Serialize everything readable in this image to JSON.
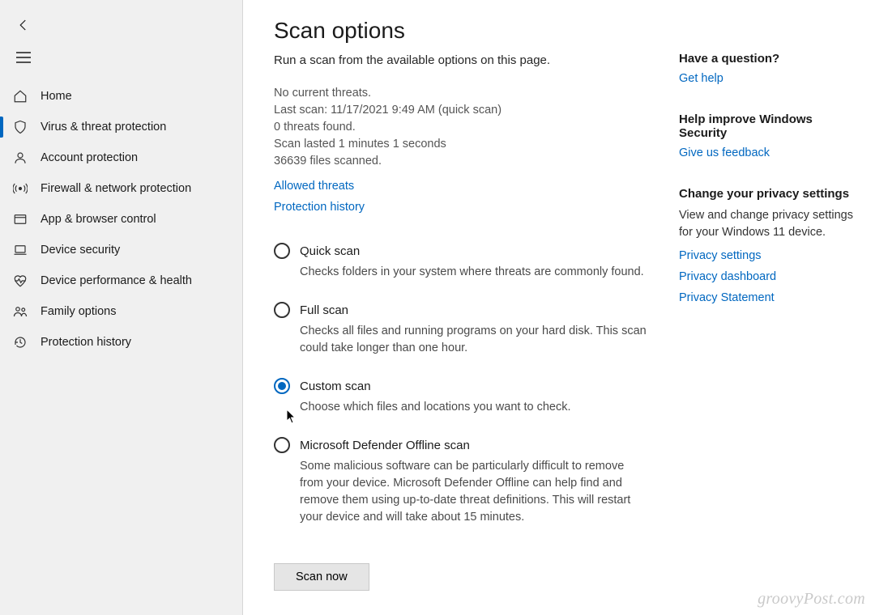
{
  "sidebar": {
    "items": [
      {
        "label": "Home"
      },
      {
        "label": "Virus & threat protection",
        "active": true
      },
      {
        "label": "Account protection"
      },
      {
        "label": "Firewall & network protection"
      },
      {
        "label": "App & browser control"
      },
      {
        "label": "Device security"
      },
      {
        "label": "Device performance & health"
      },
      {
        "label": "Family options"
      },
      {
        "label": "Protection history"
      }
    ]
  },
  "page": {
    "title": "Scan options",
    "subtitle": "Run a scan from the available options on this page.",
    "status": {
      "no_threats": "No current threats.",
      "last_scan": "Last scan: 11/17/2021 9:49 AM (quick scan)",
      "threats_found": "0 threats found.",
      "duration": "Scan lasted 1 minutes 1 seconds",
      "files_scanned": "36639 files scanned."
    },
    "links": {
      "allowed_threats": "Allowed threats",
      "protection_history": "Protection history"
    },
    "options": [
      {
        "title": "Quick scan",
        "desc": "Checks folders in your system where threats are commonly found.",
        "checked": false
      },
      {
        "title": "Full scan",
        "desc": "Checks all files and running programs on your hard disk. This scan could take longer than one hour.",
        "checked": false
      },
      {
        "title": "Custom scan",
        "desc": "Choose which files and locations you want to check.",
        "checked": true
      },
      {
        "title": "Microsoft Defender Offline scan",
        "desc": "Some malicious software can be particularly difficult to remove from your device. Microsoft Defender Offline can help find and remove them using up-to-date threat definitions. This will restart your device and will take about 15 minutes.",
        "checked": false
      }
    ],
    "scan_button": "Scan now"
  },
  "aside": {
    "question": {
      "heading": "Have a question?",
      "link": "Get help"
    },
    "improve": {
      "heading": "Help improve Windows Security",
      "link": "Give us feedback"
    },
    "privacy": {
      "heading": "Change your privacy settings",
      "text": "View and change privacy settings for your Windows 11 device.",
      "links": [
        "Privacy settings",
        "Privacy dashboard",
        "Privacy Statement"
      ]
    }
  },
  "watermark": "groovyPost.com"
}
